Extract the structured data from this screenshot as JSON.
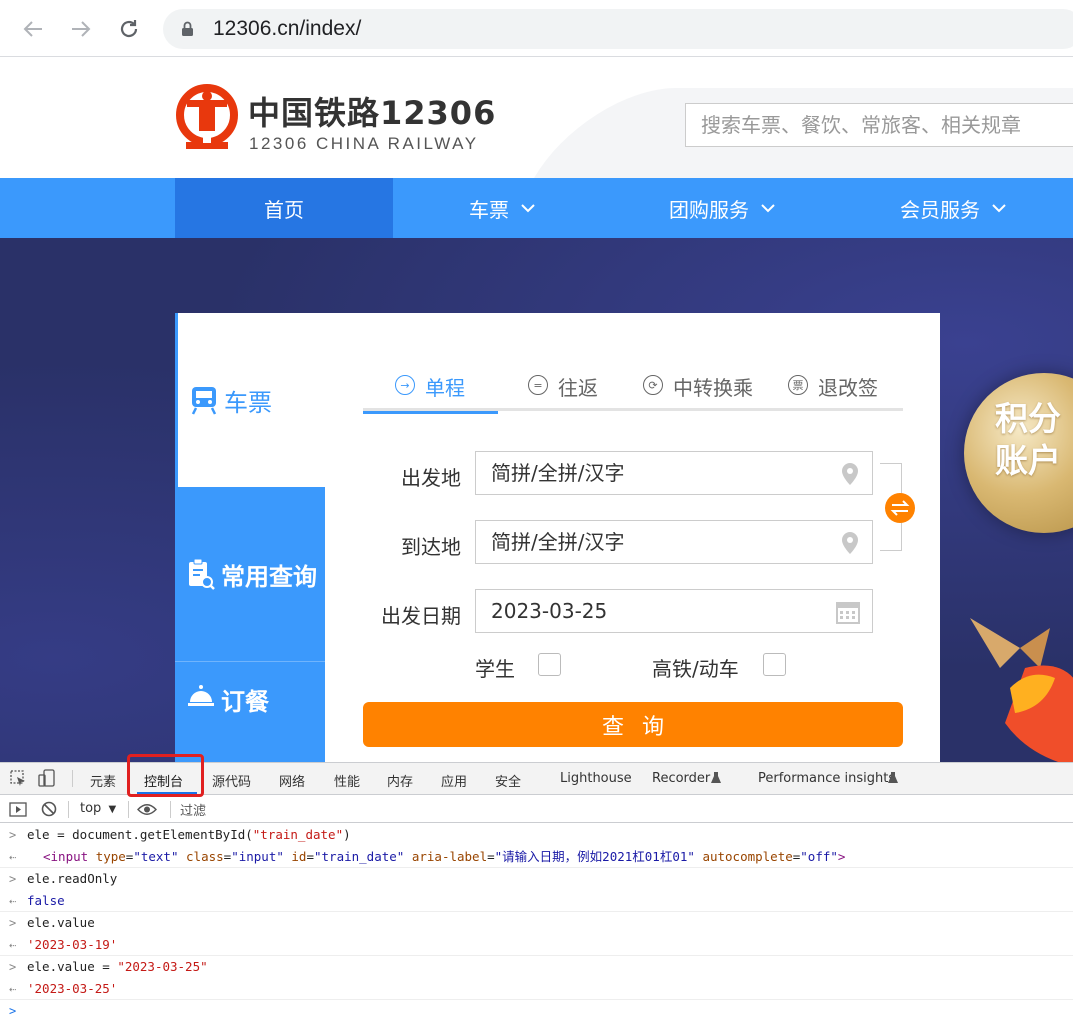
{
  "browser": {
    "url": "12306.cn/index/"
  },
  "header": {
    "logo_cn": "中国铁路12306",
    "logo_en": "12306 CHINA RAILWAY",
    "search_placeholder": "搜索车票、餐饮、常旅客、相关规章"
  },
  "main_nav": [
    {
      "label": "首页",
      "active": true
    },
    {
      "label": "车票"
    },
    {
      "label": "团购服务"
    },
    {
      "label": "会员服务"
    }
  ],
  "banner": {
    "points_badge": [
      "积分",
      "账户"
    ]
  },
  "booking": {
    "side_tabs": [
      "车票",
      "常用查询",
      "订餐"
    ],
    "trip_tabs": [
      "单程",
      "往返",
      "中转换乘",
      "退改签"
    ],
    "from_label": "出发地",
    "from_placeholder": "简拼/全拼/汉字",
    "to_label": "到达地",
    "to_placeholder": "简拼/全拼/汉字",
    "date_label": "出发日期",
    "date_value": "2023-03-25",
    "student_label": "学生",
    "highspeed_label": "高铁/动车",
    "query_button": "查询"
  },
  "devtools": {
    "tabs": [
      "元素",
      "控制台",
      "源代码",
      "网络",
      "性能",
      "内存",
      "应用",
      "安全",
      "Lighthouse",
      "Recorder",
      "Performance insights"
    ],
    "active_tab": "控制台",
    "context": "top",
    "filter_placeholder": "过滤",
    "console": {
      "l1_prefix": "ele = document.getElementById(",
      "l1_arg": "\"train_date\"",
      "l1_suffix": ")",
      "l2_tag_open": "<input",
      "l2_attr_type": "type",
      "l2_val_type": "\"text\"",
      "l2_attr_class": "class",
      "l2_val_class": "\"input\"",
      "l2_attr_id": "id",
      "l2_val_id": "\"train_date\"",
      "l2_attr_aria": "aria-label",
      "l2_val_aria": "\"请输入日期，例如2021杠01杠01\"",
      "l2_attr_auto": "autocomplete",
      "l2_val_auto": "\"off\"",
      "l2_tag_close": ">",
      "l3": "ele.readOnly",
      "l4": "false",
      "l5": "ele.value",
      "l6": "'2023-03-19'",
      "l7_prefix": "ele.value = ",
      "l7_val": "\"2023-03-25\"",
      "l8": "'2023-03-25'"
    }
  },
  "colors": {
    "brand_blue": "#3b99fc",
    "nav_active": "#2676e3",
    "orange": "#ff8200",
    "banner": "#2a3168",
    "logo_red": "#e8380d"
  }
}
